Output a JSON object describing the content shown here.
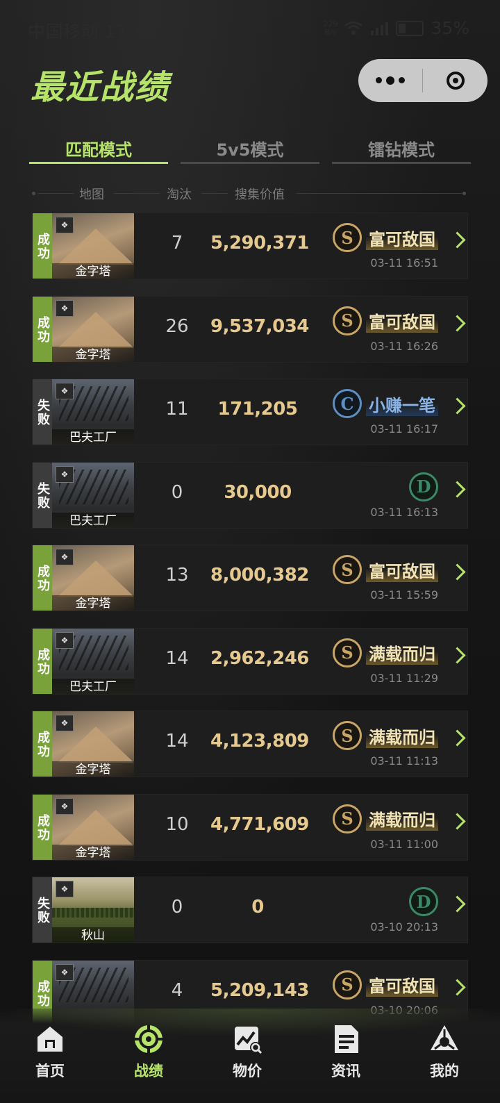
{
  "status_bar": {
    "carrier_time": "中国移动 17:37",
    "net_speed_top": "229",
    "net_speed_bottom": "B/s",
    "battery": "35%"
  },
  "header": {
    "title": "最近战绩"
  },
  "tabs": [
    {
      "label": "匹配模式",
      "active": true
    },
    {
      "label": "5v5模式",
      "active": false
    },
    {
      "label": "镭钻模式",
      "active": false
    }
  ],
  "columns": {
    "map": "地图",
    "eliminations": "淘汰",
    "value": "搜集价值"
  },
  "records": [
    {
      "result": "成功",
      "win": true,
      "map": "金字塔",
      "map_type": "pyramid",
      "eliminations": "7",
      "value": "5,290,371",
      "grade": "S",
      "title": "富可敌国",
      "time": "03-11 16:51"
    },
    {
      "result": "成功",
      "win": true,
      "map": "金字塔",
      "map_type": "pyramid",
      "eliminations": "26",
      "value": "9,537,034",
      "grade": "S",
      "title": "富可敌国",
      "time": "03-11 16:26"
    },
    {
      "result": "失败",
      "win": false,
      "map": "巴夫工厂",
      "map_type": "factory",
      "eliminations": "11",
      "value": "171,205",
      "grade": "C",
      "title": "小赚一笔",
      "time": "03-11 16:17"
    },
    {
      "result": "失败",
      "win": false,
      "map": "巴夫工厂",
      "map_type": "factory",
      "eliminations": "0",
      "value": "30,000",
      "grade": "D",
      "title": "",
      "time": "03-11 16:13"
    },
    {
      "result": "成功",
      "win": true,
      "map": "金字塔",
      "map_type": "pyramid",
      "eliminations": "13",
      "value": "8,000,382",
      "grade": "S",
      "title": "富可敌国",
      "time": "03-11 15:59"
    },
    {
      "result": "成功",
      "win": true,
      "map": "巴夫工厂",
      "map_type": "factory",
      "eliminations": "14",
      "value": "2,962,246",
      "grade": "S",
      "title": "满载而归",
      "time": "03-11 11:29"
    },
    {
      "result": "成功",
      "win": true,
      "map": "金字塔",
      "map_type": "pyramid",
      "eliminations": "14",
      "value": "4,123,809",
      "grade": "S",
      "title": "满载而归",
      "time": "03-11 11:13"
    },
    {
      "result": "成功",
      "win": true,
      "map": "金字塔",
      "map_type": "pyramid",
      "eliminations": "10",
      "value": "4,771,609",
      "grade": "S",
      "title": "满载而归",
      "time": "03-11 11:00"
    },
    {
      "result": "失败",
      "win": false,
      "map": "秋山",
      "map_type": "autumn",
      "eliminations": "0",
      "value": "0",
      "grade": "D",
      "title": "",
      "time": "03-10 20:13"
    },
    {
      "result": "成功",
      "win": true,
      "map": "",
      "map_type": "factory",
      "eliminations": "4",
      "value": "5,209,143",
      "grade": "S",
      "title": "富可敌国",
      "time": "03-10 20:06"
    }
  ],
  "nav": [
    {
      "label": "首页",
      "icon": "home-icon",
      "active": false
    },
    {
      "label": "战绩",
      "icon": "crosshair-icon",
      "active": true
    },
    {
      "label": "物价",
      "icon": "price-chart-icon",
      "active": false
    },
    {
      "label": "资讯",
      "icon": "news-icon",
      "active": false
    },
    {
      "label": "我的",
      "icon": "profile-icon",
      "active": false
    }
  ],
  "colors": {
    "accent": "#b6e46a",
    "win": "#7aa23a",
    "lose": "#3c3c3c",
    "value": "#e5c98f",
    "gold": "#c9a566",
    "blue": "#5d8ec2",
    "green": "#3a8a6a"
  }
}
